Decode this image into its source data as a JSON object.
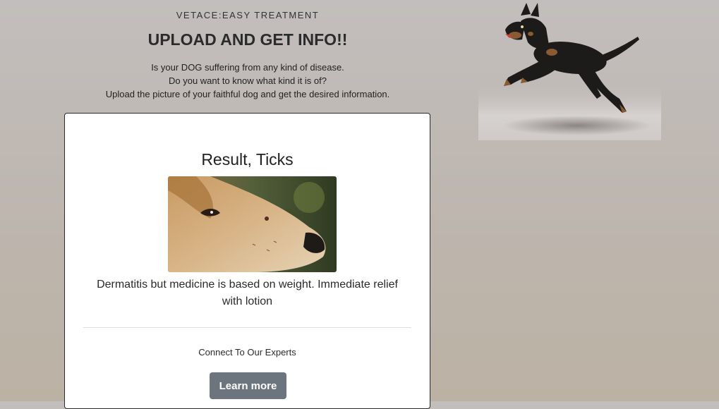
{
  "header": {
    "brand": "VETACE:EASY TREATMENT",
    "headline": "UPLOAD AND GET INFO!!",
    "intro_lines": [
      "Is your DOG suffering from any kind of disease.",
      "Do you want to know what kind it is of?",
      "Upload the picture of your faithful dog and get the desired information."
    ]
  },
  "result": {
    "title": "Result, Ticks",
    "description": "Dermatitis but medicine is based on weight. Immediate relief with lotion",
    "connect_text": "Connect To Our Experts",
    "button_label": "Learn more"
  },
  "colors": {
    "button": "#6c757d",
    "card_border": "#2b2b2b",
    "background_top": "#c2bebd",
    "background_bottom": "#bcb2a4"
  }
}
